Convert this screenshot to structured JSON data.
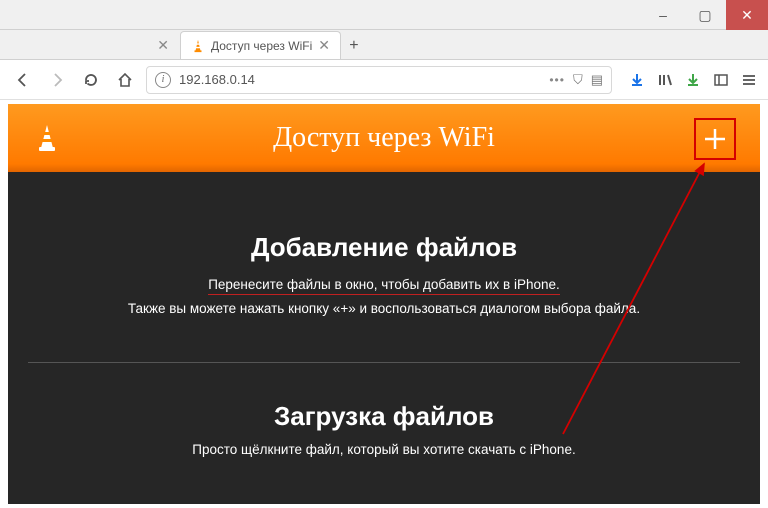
{
  "window": {
    "minimize": "–",
    "maximize": "▢",
    "close": "✕"
  },
  "tabs": {
    "tab1_close": "✕",
    "tab2_title": "Доступ через WiFi",
    "tab2_close": "✕",
    "newtab": "+"
  },
  "toolbar": {
    "url": "192.168.0.14",
    "ellipsis": "•••",
    "shield": "⛉",
    "reader": "▤"
  },
  "page": {
    "header_title": "Доступ через WiFi",
    "section1_heading": "Добавление файлов",
    "section1_line1": "Перенесите файлы в окно, чтобы добавить их в iPhone.",
    "section1_line2": "Также вы можете нажать кнопку «+» и воспользоваться диалогом выбора файла.",
    "section2_heading": "Загрузка файлов",
    "section2_line1": "Просто щёлкните файл, который вы хотите скачать с iPhone."
  }
}
